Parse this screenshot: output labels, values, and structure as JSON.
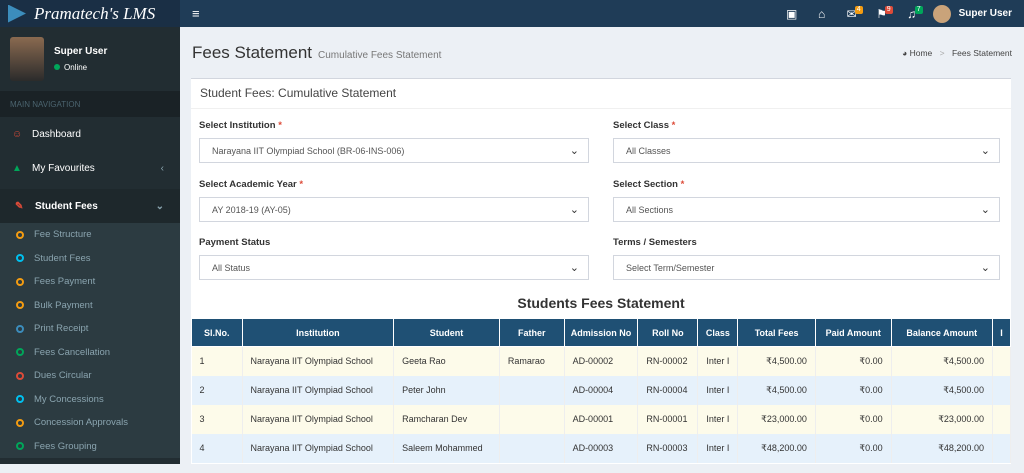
{
  "app": {
    "brand": "Pramatech's LMS",
    "user_name": "Super User"
  },
  "topbar": {
    "icons": [
      {
        "name": "film-icon",
        "glyph": "▣",
        "badge": "",
        "badge_color": ""
      },
      {
        "name": "basket-icon",
        "glyph": "⌂",
        "badge": "",
        "badge_color": ""
      },
      {
        "name": "envelope-icon",
        "glyph": "✉",
        "badge": "4",
        "badge_color": "#f39c12"
      },
      {
        "name": "flag-icon",
        "glyph": "⚑",
        "badge": "9",
        "badge_color": "#dd4b39"
      },
      {
        "name": "bell-icon",
        "glyph": "♫",
        "badge": "7",
        "badge_color": "#00a65a"
      }
    ]
  },
  "sidebar": {
    "user_name": "Super User",
    "status": "Online",
    "nav_header": "MAIN NAVIGATION",
    "items": [
      {
        "label": "Dashboard",
        "icon": "dashboard-icon",
        "glyph": "☺",
        "color": "#dd4b39"
      },
      {
        "label": "My Favourites",
        "icon": "bag-icon",
        "glyph": "▲",
        "color": "#00a65a"
      },
      {
        "label": "Student Fees",
        "icon": "edit-icon",
        "glyph": "✎",
        "color": "#dd4b39"
      }
    ],
    "sub_items": [
      {
        "label": "Fee Structure",
        "color": "#f39c12"
      },
      {
        "label": "Student Fees",
        "color": "#00c0ef"
      },
      {
        "label": "Fees Payment",
        "color": "#f39c12"
      },
      {
        "label": "Bulk Payment",
        "color": "#f39c12"
      },
      {
        "label": "Print Receipt",
        "color": "#3c8dbc"
      },
      {
        "label": "Fees Cancellation",
        "color": "#00a65a"
      },
      {
        "label": "Dues Circular",
        "color": "#dd4b39"
      },
      {
        "label": "My Concessions",
        "color": "#00c0ef"
      },
      {
        "label": "Concession Approvals",
        "color": "#f39c12"
      },
      {
        "label": "Fees Grouping",
        "color": "#00a65a"
      }
    ]
  },
  "header": {
    "title": "Fees Statement",
    "subtitle": "Cumulative Fees Statement",
    "breadcrumb_home": "Home",
    "breadcrumb_current": "Fees Statement"
  },
  "box": {
    "title": "Student Fees: Cumulative Statement"
  },
  "form": {
    "institution_label": "Select Institution",
    "institution_value": "Narayana IIT Olympiad School (BR-06-INS-006)",
    "class_label": "Select Class",
    "class_value": "All Classes",
    "year_label": "Select Academic Year",
    "year_value": "AY 2018-19 (AY-05)",
    "section_label": "Select Section",
    "section_value": "All Sections",
    "payment_label": "Payment Status",
    "payment_value": "All Status",
    "terms_label": "Terms / Semesters",
    "terms_value": "Select Term/Semester"
  },
  "table": {
    "title": "Students Fees Statement",
    "columns": [
      "Sl.No.",
      "Institution",
      "Student",
      "Father",
      "Admission No",
      "Roll No",
      "Class",
      "Total Fees",
      "Paid Amount",
      "Balance Amount",
      "I"
    ],
    "rows": [
      [
        "1",
        "Narayana IIT Olympiad School",
        "Geeta Rao",
        "Ramarao",
        "AD-00002",
        "RN-00002",
        "Inter I",
        "₹4,500.00",
        "₹0.00",
        "₹4,500.00"
      ],
      [
        "2",
        "Narayana IIT Olympiad School",
        "Peter John",
        "",
        "AD-00004",
        "RN-00004",
        "Inter I",
        "₹4,500.00",
        "₹0.00",
        "₹4,500.00"
      ],
      [
        "3",
        "Narayana IIT Olympiad School",
        "Ramcharan Dev",
        "",
        "AD-00001",
        "RN-00001",
        "Inter I",
        "₹23,000.00",
        "₹0.00",
        "₹23,000.00"
      ],
      [
        "4",
        "Narayana IIT Olympiad School",
        "Saleem Mohammed",
        "",
        "AD-00003",
        "RN-00003",
        "Inter I",
        "₹48,200.00",
        "₹0.00",
        "₹48,200.00"
      ]
    ]
  }
}
